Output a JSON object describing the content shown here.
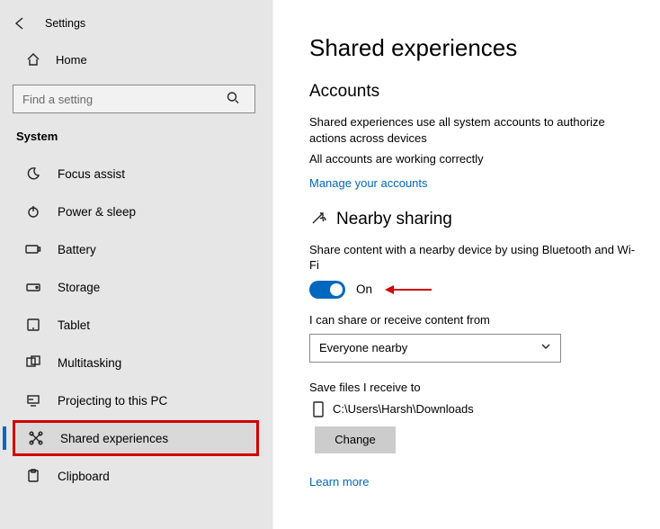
{
  "window": {
    "title": "Settings"
  },
  "sidebar": {
    "home_label": "Home",
    "search_placeholder": "Find a setting",
    "section_header": "System",
    "items": [
      {
        "label": "Focus assist"
      },
      {
        "label": "Power & sleep"
      },
      {
        "label": "Battery"
      },
      {
        "label": "Storage"
      },
      {
        "label": "Tablet"
      },
      {
        "label": "Multitasking"
      },
      {
        "label": "Projecting to this PC"
      },
      {
        "label": "Shared experiences"
      },
      {
        "label": "Clipboard"
      }
    ]
  },
  "page": {
    "title": "Shared experiences",
    "accounts": {
      "heading": "Accounts",
      "desc": "Shared experiences use all system accounts to authorize actions across devices",
      "status": "All accounts are working correctly",
      "manage_link": "Manage your accounts"
    },
    "nearby": {
      "heading": "Nearby sharing",
      "desc": "Share content with a nearby device by using Bluetooth and Wi-Fi",
      "toggle_state": "On",
      "scope_label": "I can share or receive content from",
      "scope_value": "Everyone nearby",
      "save_label": "Save files I receive to",
      "save_path": "C:\\Users\\Harsh\\Downloads",
      "change_label": "Change",
      "learn_more": "Learn more"
    }
  }
}
